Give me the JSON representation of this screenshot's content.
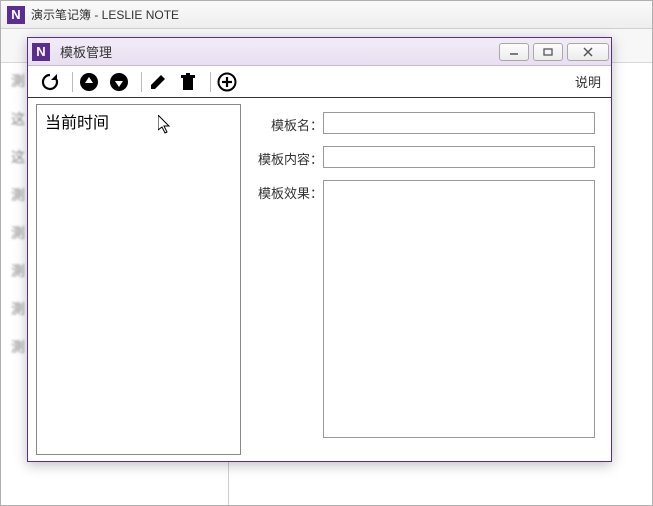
{
  "parent": {
    "title": "演示笔记簿 - LESLIE NOTE"
  },
  "dialog": {
    "title": "模板管理",
    "help_label": "说明",
    "list": {
      "items": [
        "当前时间"
      ]
    },
    "form": {
      "name_label": "模板名：",
      "name_value": "",
      "content_label": "模板内容：",
      "content_value": "",
      "effect_label": "模板效果：",
      "effect_value": ""
    }
  },
  "win_controls": {
    "min": "minimize",
    "max": "maximize",
    "close": "close"
  },
  "colors": {
    "brand": "#5a2e8f"
  }
}
